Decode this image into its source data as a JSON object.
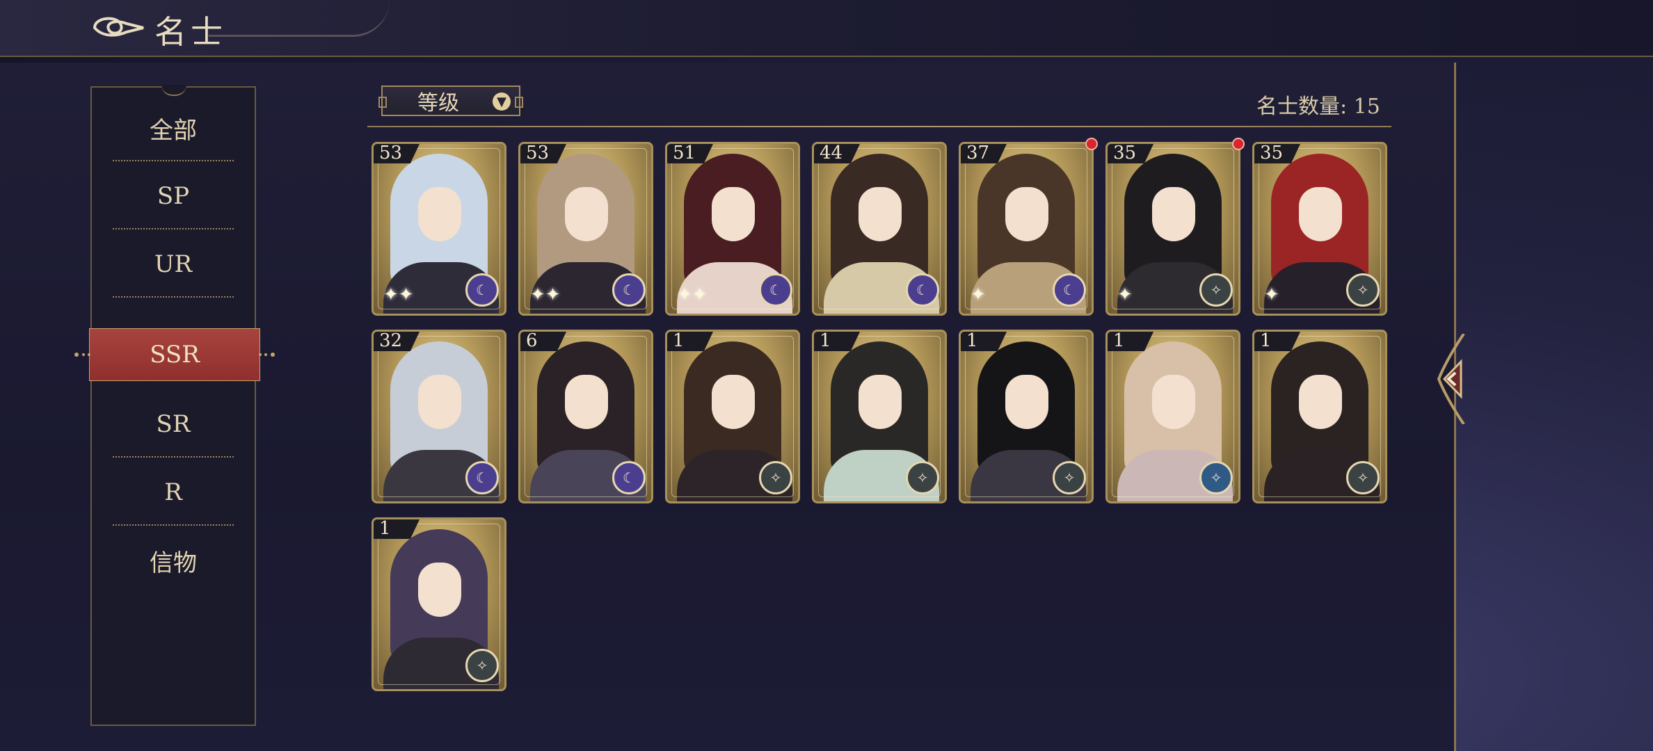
{
  "header": {
    "title": "名士"
  },
  "sidebar": {
    "items": [
      {
        "label": "全部"
      },
      {
        "label": "SP"
      },
      {
        "label": "UR"
      },
      {
        "label": "SSR",
        "active": true
      },
      {
        "label": "SR"
      },
      {
        "label": "R"
      },
      {
        "label": "信物"
      }
    ]
  },
  "toolbar": {
    "sort_label": "等级",
    "count_label": "名士数量: 15"
  },
  "cards": [
    {
      "level": "53",
      "badge": "moon-icon",
      "hair": "#c9d6e6",
      "body": "#2e2c38",
      "sparkles": "✦✦"
    },
    {
      "level": "53",
      "badge": "moon-icon",
      "hair": "#b19a80",
      "body": "#2b2630",
      "sparkles": "✦✦"
    },
    {
      "level": "51",
      "badge": "moon-icon",
      "hair": "#4a1d22",
      "body": "#e6d2c8",
      "sparkles": "✦✦"
    },
    {
      "level": "44",
      "badge": "moon-icon",
      "hair": "#3a2a24",
      "body": "#d6c9a8",
      "sparkles": ""
    },
    {
      "level": "37",
      "badge": "moon-icon",
      "hair": "#4a3628",
      "body": "#b8a07a",
      "sparkles": "✦"
    },
    {
      "level": "35",
      "badge": "star-icon",
      "hair": "#1f1c20",
      "body": "#2d2a30",
      "sparkles": "✦"
    },
    {
      "level": "35",
      "badge": "star-icon",
      "hair": "#9b2424",
      "body": "#26202a",
      "sparkles": "✦"
    },
    {
      "level": "32",
      "badge": "moon-icon",
      "hair": "#c7cdd6",
      "body": "#3a3740",
      "sparkles": ""
    },
    {
      "level": "6",
      "badge": "moon-icon",
      "hair": "#2a2226",
      "body": "#4a4458",
      "sparkles": ""
    },
    {
      "level": "1",
      "badge": "star-icon",
      "hair": "#3b2a22",
      "body": "#2c2428",
      "sparkles": ""
    },
    {
      "level": "1",
      "badge": "star-icon",
      "hair": "#2a2826",
      "body": "#bfd0c4",
      "sparkles": ""
    },
    {
      "level": "1",
      "badge": "star-icon",
      "hair": "#151416",
      "body": "#3a3642",
      "sparkles": ""
    },
    {
      "level": "1",
      "badge": "blue-icon",
      "hair": "#d8c0a8",
      "body": "#cbb8b6",
      "sparkles": ""
    },
    {
      "level": "1",
      "badge": "star-icon",
      "hair": "#2b2322",
      "body": "#2a2224",
      "sparkles": ""
    },
    {
      "level": "1",
      "badge": "star-icon",
      "hair": "#453a58",
      "body": "#2e2a34",
      "sparkles": ""
    }
  ],
  "notifications": [
    {
      "card": 4
    },
    {
      "card": 5
    }
  ]
}
